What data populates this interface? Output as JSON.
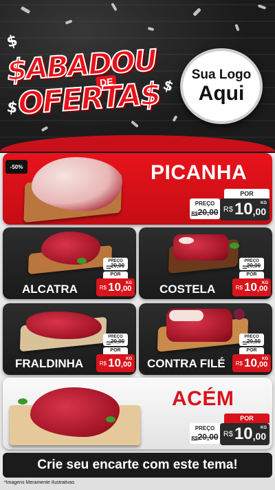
{
  "header": {
    "title_line1": "$ABADOU",
    "title_de": "DE",
    "title_line2": "OFERTA$",
    "logo_line1": "Sua Logo",
    "logo_line2": "Aqui"
  },
  "discount_badge": "-50%",
  "labels": {
    "preco": "PREÇO",
    "por": "POR",
    "currency": "R$",
    "unit": "KG"
  },
  "products": [
    {
      "name": "PICANHA",
      "old_price": "20,00",
      "price_int": "10",
      "price_dec": ",00"
    },
    {
      "name": "ALCATRA",
      "old_price": "20,00",
      "price_int": "10",
      "price_dec": ",00"
    },
    {
      "name": "COSTELA",
      "old_price": "20,00",
      "price_int": "10",
      "price_dec": ",00"
    },
    {
      "name": "FRALDINHA",
      "old_price": "20,00",
      "price_int": "10",
      "price_dec": ",00"
    },
    {
      "name": "CONTRA FILÉ",
      "old_price": "20,00",
      "price_int": "10",
      "price_dec": ",00"
    },
    {
      "name": "ACÉM",
      "old_price": "20,00",
      "price_int": "10",
      "price_dec": ",00"
    }
  ],
  "cta": "Crie seu encarte com este tema!",
  "disclaimer": "*Imagens Meramente Ilustrativas",
  "colors": {
    "brand_red": "#e8131c",
    "dark": "#1c1c1c"
  }
}
